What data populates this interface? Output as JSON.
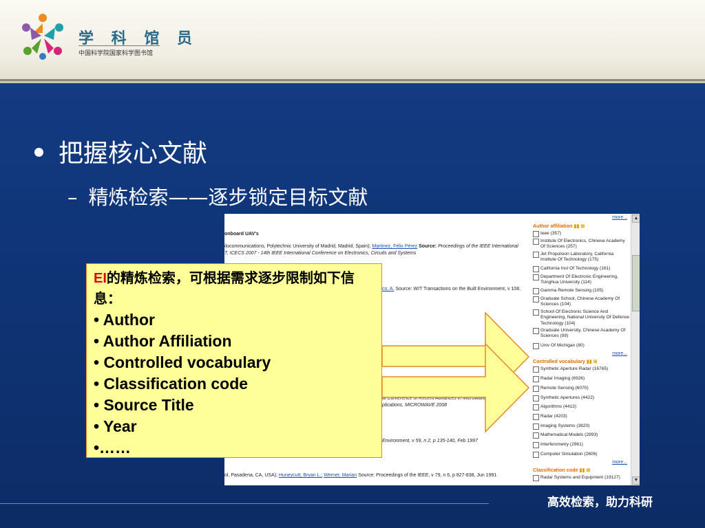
{
  "header": {
    "logo_title": "学 科 馆 员",
    "logo_subtitle": "中国科学院国家科学图书馆"
  },
  "main": {
    "bullet_1": "把握核心文献",
    "bullet_2_dash": "–",
    "bullet_2": "精炼检索——逐步锁定目标文献"
  },
  "screenshot": {
    "results": [
      {
        "text": "onboard UAV's",
        "bold": true
      },
      {
        "text": "ilocommunications, Polytechnic University of Madrid, Madrid, Spain);"
      },
      {
        "text": "Martinez, Félix Pérez",
        "link": true
      },
      {
        "text": "Source:"
      },
      {
        "text": "Proceedings of the IEEE International"
      },
      {
        "text": "T, ICECS 2007 - 14th IEEE International Conference on Electronics, Circuits and Systems"
      },
      {
        "text": "co, A."
      },
      {
        "text": "Source: WIT Transactions on the Built Environment, v 108,"
      },
      {
        "text": "al Conference of Recent Advances in Microwave Theory and"
      },
      {
        "text": "plications, MICROWAVE 2008"
      },
      {
        "text": "Environment, v 59, n 2, p 135-140, Feb 1997"
      },
      {
        "text": "ol, Pasadena, CA, USA);"
      },
      {
        "text": "Huneycutt, Bryan L.;"
      },
      {
        "text": "Werner, Marian"
      },
      {
        "text": "Source: Proceedings of the IEEE, v 79, n 6, p 827-838, Jun 1991"
      }
    ],
    "more_label": "more...",
    "author_affiliation": {
      "title": "Author affiliation",
      "items": [
        "Ieee (357)",
        "Institute Of Electronics, Chinese Academy Of Sciences (257)",
        "Jet Propulsion Laboratory, California Institute Of Technology (175)",
        "California Inst Of Technology (161)",
        "Department Of Electronic Engineering, Tsinghua University (114)",
        "Gamma Remote Sensing (105)",
        "Graduate School, Chinese Academy Of Sciences (104)",
        "School Of Electronic Science And Engineering, National University Of Defense Technology (104)",
        "Graduate University, Chinese Academy Of Sciences (99)",
        "Univ Of Michigan (80)"
      ]
    },
    "controlled_vocabulary": {
      "title": "Controlled vocabulary",
      "items": [
        "Synthetic Aperture Radar (16765)",
        "Radar Imaging (6926)",
        "Remote Sensing (6070)",
        "Synthetic Apertures (4422)",
        "Algorithms (4413)",
        "Radar (4203)",
        "Imaging Systems (3820)",
        "Mathematical Models (2993)",
        "Interferometry (2961)",
        "Computer Simulation (2606)"
      ]
    },
    "classification_code": {
      "title": "Classification code",
      "items": [
        "Radar Systems and Equipment (19127)"
      ]
    }
  },
  "callout": {
    "ei": "EI",
    "intro": "的精炼检索，可根据需求逐步限制如下信息：",
    "items": [
      "• Author",
      "• Author Affiliation",
      "• Controlled vocabulary",
      "• Classification code",
      "• Source Title",
      "• Year",
      "•……"
    ]
  },
  "footer": {
    "slogan": "高效检索，助力科研"
  },
  "colors": {
    "background": "#133a80",
    "callout_fill": "#ffff99",
    "callout_border": "#e08a2a",
    "accent_orange": "#e06b00",
    "ei_red": "#e00000"
  }
}
